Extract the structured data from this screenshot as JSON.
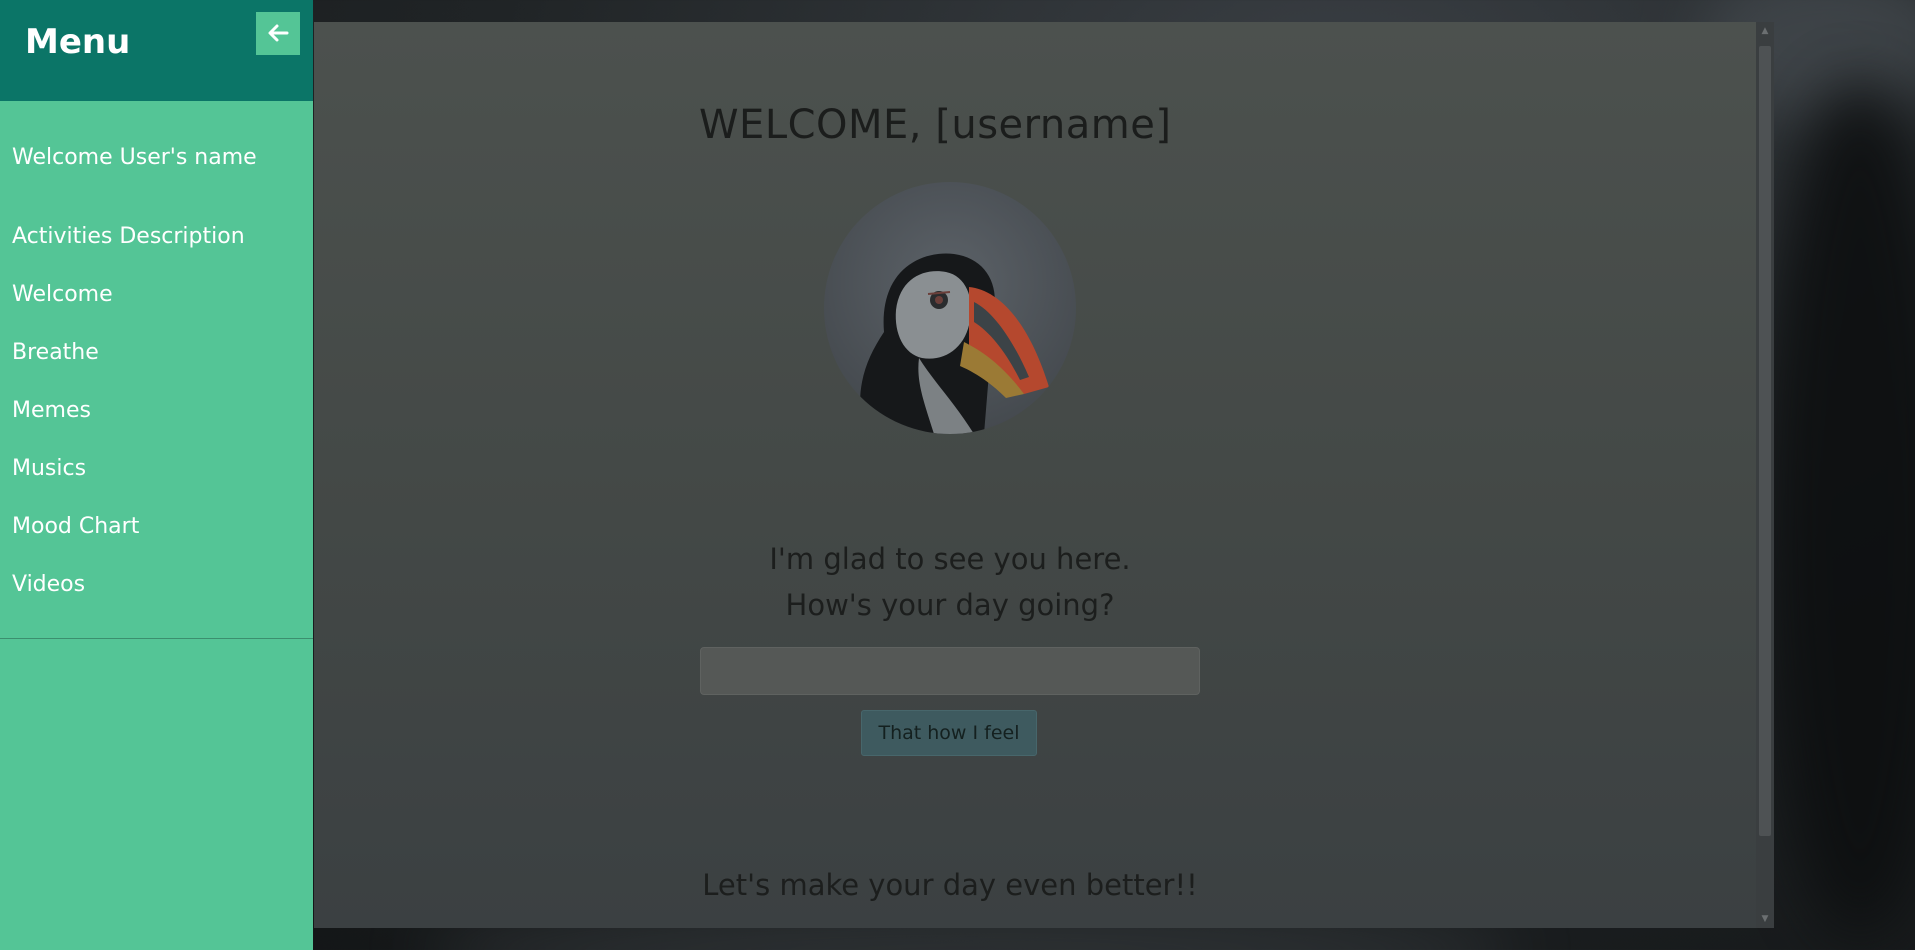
{
  "sidebar": {
    "title": "Menu",
    "user_label": "Welcome User's name",
    "items": [
      {
        "label": "Activities Description"
      },
      {
        "label": "Welcome"
      },
      {
        "label": "Breathe"
      },
      {
        "label": "Memes"
      },
      {
        "label": "Musics"
      },
      {
        "label": "Mood Chart"
      },
      {
        "label": "Videos"
      }
    ],
    "close_icon": "arrow-left-icon",
    "accent_color": "#54c596",
    "header_color": "#0b7567"
  },
  "main": {
    "title": "WELCOME, [username]",
    "avatar_icon": "puffin-avatar",
    "greeting_line1": "I'm glad to see you here.",
    "greeting_line2": "How's your day going?",
    "feeling_input": {
      "value": "",
      "placeholder": ""
    },
    "submit_label": "That how I feel",
    "footer_heading": "Let's make your day even better!!"
  }
}
